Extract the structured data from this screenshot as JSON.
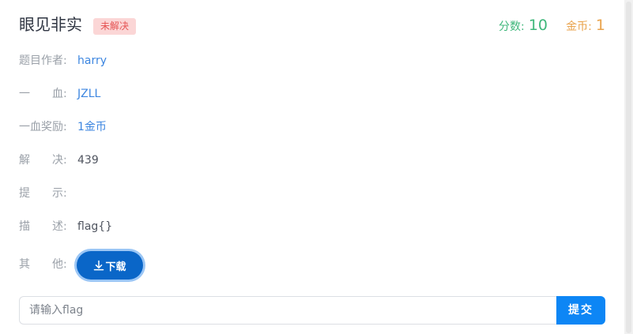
{
  "challenge": {
    "title": "眼见非实",
    "status_badge": "未解决"
  },
  "stats": {
    "score_label": "分数:",
    "score_value": "10",
    "coin_label": "金币:",
    "coin_value": "1"
  },
  "details": {
    "author_label": "题目作者:",
    "author_value": "harry",
    "first_blood_label": "一　　血:",
    "first_blood_value": "JZLL",
    "first_blood_reward_label": "一血奖励:",
    "first_blood_reward_value": "1金币",
    "solves_label": "解　　决:",
    "solves_value": "439",
    "hint_label": "提　　示:",
    "hint_value": "",
    "description_label": "描　　述:",
    "description_value": "flag{}",
    "other_label": "其　　他:"
  },
  "actions": {
    "download_label": "下载",
    "flag_placeholder": "请输入flag",
    "flag_value": "",
    "submit_label": "提交"
  },
  "colors": {
    "score": "#3fb77b",
    "coin": "#e9a34c",
    "link": "#3d86e0",
    "badge_bg": "#fbd6d6",
    "badge_text": "#e55353",
    "download_button": "#0a66c8",
    "submit_button": "#0d86f5"
  }
}
